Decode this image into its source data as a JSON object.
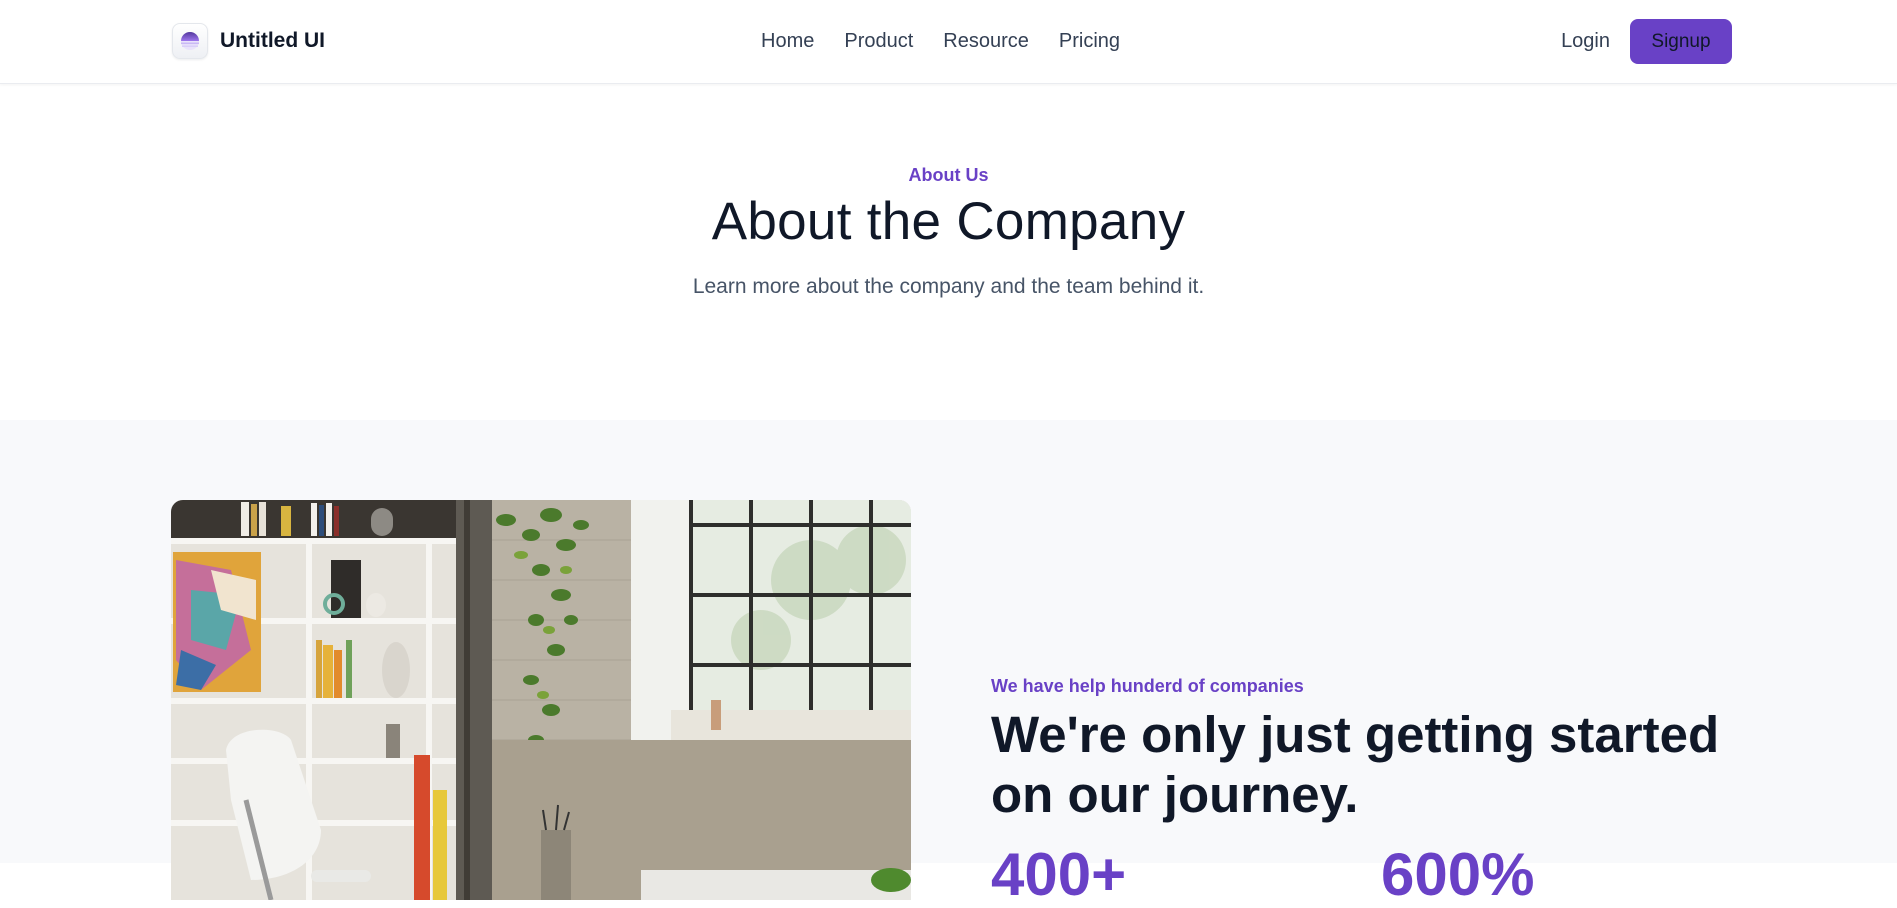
{
  "brand": {
    "name": "Untitled UI",
    "logo_icon": "half-circle-logo-icon",
    "accent": "#6941c6"
  },
  "nav": {
    "links": [
      "Home",
      "Product",
      "Resource",
      "Pricing"
    ]
  },
  "auth": {
    "login_label": "Login",
    "signup_label": "Signup"
  },
  "hero": {
    "eyebrow": "About Us",
    "title": "About the Company",
    "subtitle": "Learn more about the company and the team behind it."
  },
  "about": {
    "image_alt": "office-workspace-photo",
    "eyebrow": "We have help hunderd of companies",
    "title": "We're only just getting started on our journey.",
    "stats": [
      "400+",
      "600%"
    ]
  },
  "colors": {
    "accent": "#6941c6",
    "text_primary": "#101828",
    "text_secondary": "#475467",
    "section_bg": "#f8f9fb"
  }
}
